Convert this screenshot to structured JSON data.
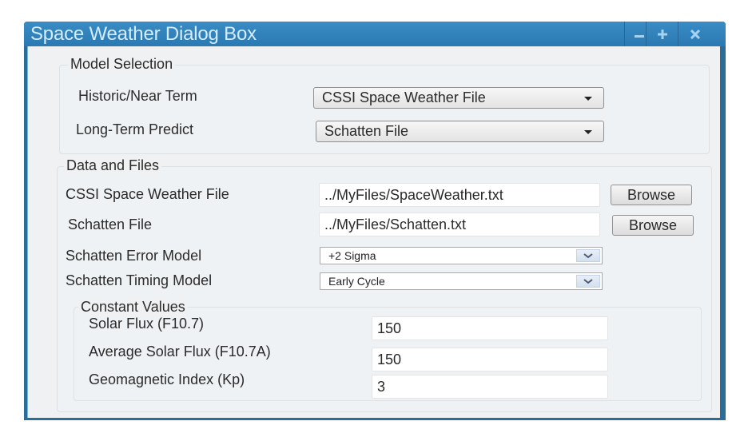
{
  "window": {
    "title": "Space Weather Dialog Box",
    "controls": [
      {
        "name": "minimize",
        "icon": "minimize-icon"
      },
      {
        "name": "maximize",
        "icon": "move-plus-icon"
      },
      {
        "name": "close",
        "icon": "close-icon"
      }
    ]
  },
  "model_selection": {
    "legend": "Model Selection",
    "historic_label": "Historic/Near Term",
    "historic_value": "CSSI Space Weather File",
    "longterm_label": "Long-Term Predict",
    "longterm_value": "Schatten File"
  },
  "data_files": {
    "legend": "Data and Files",
    "cssi_label": "CSSI Space Weather File",
    "cssi_path": "../MyFiles/SpaceWeather.txt",
    "schatten_label": "Schatten File",
    "schatten_path": "../MyFiles/Schatten.txt",
    "browse_label": "Browse",
    "error_model_label": "Schatten Error Model",
    "error_model_value": "+2 Sigma",
    "timing_model_label": "Schatten Timing Model",
    "timing_model_value": "Early Cycle"
  },
  "constants": {
    "legend": "Constant Values",
    "solar_flux_label": "Solar Flux (F10.7)",
    "solar_flux_value": "150",
    "avg_solar_flux_label": "Average Solar Flux (F10.7A)",
    "avg_solar_flux_value": "150",
    "geomag_label": "Geomagnetic Index (Kp)",
    "geomag_value": "3"
  },
  "colors": {
    "titlebar": "#2a79b2",
    "frame": "#2a6d98",
    "title_text": "#d4ecff",
    "body": "#f0f1f2"
  }
}
